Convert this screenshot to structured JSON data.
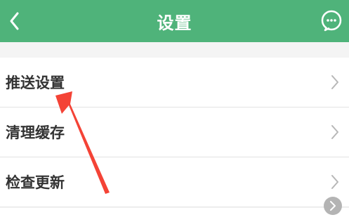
{
  "header": {
    "title": "设置",
    "back_icon": "chevron-left-icon",
    "message_icon": "chat-bubble-icon"
  },
  "menu": {
    "items": [
      {
        "label": "推送设置",
        "icon": "chevron-right-icon"
      },
      {
        "label": "清理缓存",
        "icon": "chevron-right-icon"
      },
      {
        "label": "检查更新",
        "icon": "chevron-right-icon"
      }
    ]
  },
  "floating_button": {
    "icon": "chevron-right-icon"
  },
  "theme": {
    "header_bg": "#4fb37a",
    "arrow_color": "#f44336",
    "page_bg": "#f4f4f4"
  }
}
